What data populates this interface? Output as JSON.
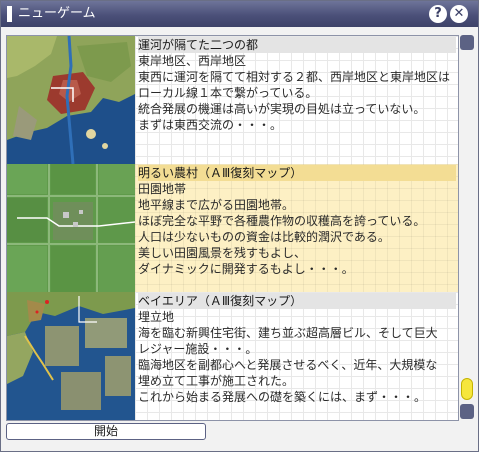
{
  "window": {
    "title": "ニューゲーム",
    "help_glyph": "?",
    "close_glyph": "✕"
  },
  "maps": [
    {
      "name": "運河が隔てた二つの都",
      "lines": [
        "東岸地区、西岸地区",
        "東西に運河を隔てて相対する２都、西岸地区と東岸地区は",
        "ローカル線１本で繋がっている。",
        "統合発展の機運は高いが実現の目処は立っていない。",
        "まずは東西交流の・・・。"
      ]
    },
    {
      "name": "明るい農村（ＡⅢ復刻マップ）",
      "lines": [
        "田園地帯",
        "地平線まで広がる田園地帯。",
        "ほぼ完全な平野で各種農作物の収穫高を誇っている。",
        "人口は少ないものの資金は比較的潤沢である。",
        "美しい田園風景を残すもよし、",
        "ダイナミックに開発するもよし・・・。"
      ]
    },
    {
      "name": "ベイエリア（ＡⅢ復刻マップ）",
      "lines": [
        "埋立地",
        "海を臨む新興住宅街、建ち並ぶ超高層ビル、そして巨大",
        "レジャー施設・・・。",
        "臨海地区を副都心へと発展させるべく、近年、大規模な",
        "埋め立て工事が施工された。",
        "これから始まる発展への礎を築くには、まず・・・。"
      ]
    }
  ],
  "footer": {
    "start_label": "開始"
  }
}
